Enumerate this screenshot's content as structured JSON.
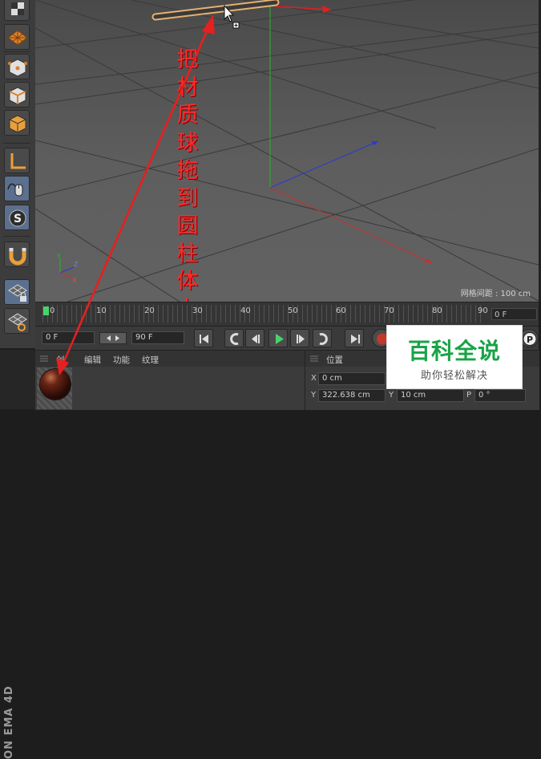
{
  "viewport": {
    "grid_spacing_label": "网格间距 : 100 cm",
    "annotation": "把材质球拖到圆柱体上"
  },
  "timeline": {
    "ticks": [
      "0",
      "10",
      "20",
      "30",
      "40",
      "50",
      "60",
      "70",
      "80",
      "90"
    ],
    "end_frame": "0 F"
  },
  "transport": {
    "current_frame": "0 F",
    "max_frame": "90 F"
  },
  "material_manager": {
    "menu": [
      "创",
      "编辑",
      "功能",
      "纹理"
    ]
  },
  "brand": {
    "text": "ON  EMA 4D"
  },
  "coordinates": {
    "header": "位置",
    "x_label": "X",
    "x_value": "0 cm",
    "y_label": "Y",
    "y_value": "322.638 cm",
    "y2_label": "Y",
    "y2_value": "10 cm",
    "p_label": "P",
    "p_value": "0 °"
  },
  "watermark": {
    "title": "百科全说",
    "subtitle": "助你轻松解决"
  },
  "colors": {
    "annotation_red": "#ff2a2a",
    "watermark_green": "#19a346",
    "axis_green": "#2ab42a",
    "axis_blue": "#2a3ad0",
    "axis_red": "#c83030"
  }
}
